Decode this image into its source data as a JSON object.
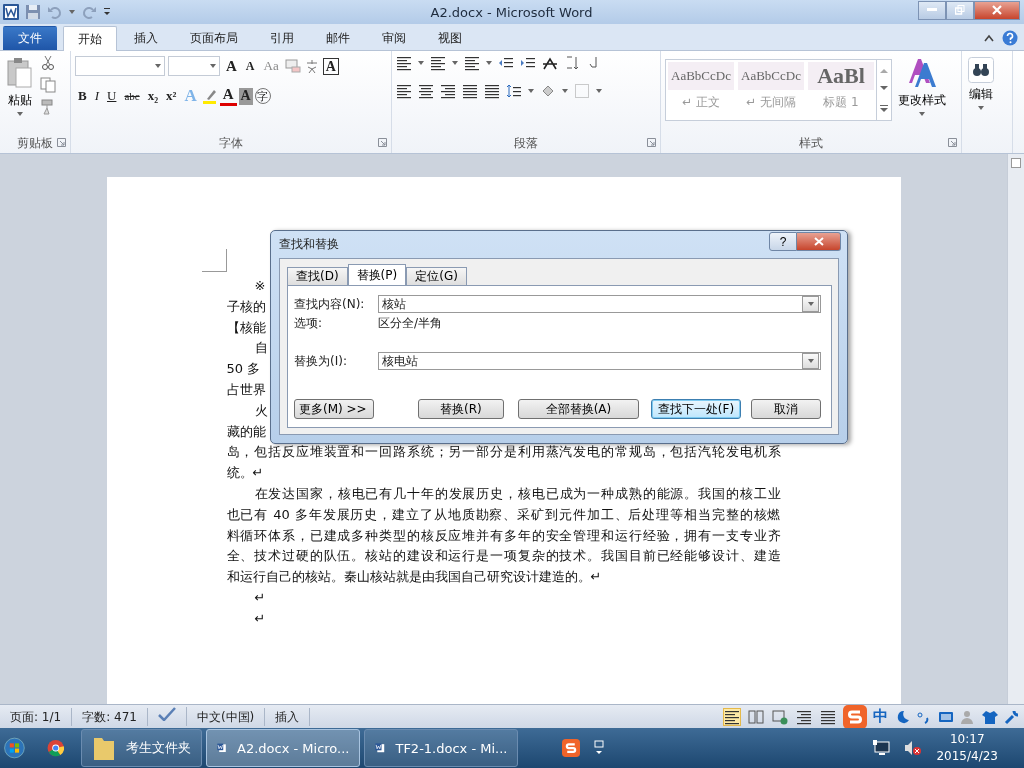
{
  "window": {
    "title": "A2.docx - Microsoft Word"
  },
  "ribbon_tabs": [
    {
      "label": "文件",
      "kind": "file",
      "selected": false
    },
    {
      "label": "开始",
      "kind": "tab",
      "selected": true
    },
    {
      "label": "插入",
      "kind": "tab",
      "selected": false
    },
    {
      "label": "页面布局",
      "kind": "tab",
      "selected": false
    },
    {
      "label": "引用",
      "kind": "tab",
      "selected": false
    },
    {
      "label": "邮件",
      "kind": "tab",
      "selected": false
    },
    {
      "label": "审阅",
      "kind": "tab",
      "selected": false
    },
    {
      "label": "视图",
      "kind": "tab",
      "selected": false
    }
  ],
  "clipboard": {
    "paste": "粘贴",
    "group": "剪贴板"
  },
  "font": {
    "group": "字体",
    "grow": "A",
    "shrink": "A",
    "case": "Aa",
    "border_char": "A",
    "format": [
      {
        "label": "B",
        "kind": "bold"
      },
      {
        "label": "I",
        "kind": "italic"
      },
      {
        "label": "U",
        "kind": "underline"
      },
      {
        "label": "abc",
        "kind": "strike"
      },
      {
        "label": "x₂",
        "kind": "sub"
      },
      {
        "label": "x²",
        "kind": "sup"
      }
    ],
    "effect": "A",
    "font_color_char": "A",
    "shading": "A",
    "enclose": "字"
  },
  "paragraph": {
    "group": "段落"
  },
  "styles": {
    "group": "样式",
    "items": [
      {
        "sample": "AaBbCcDc",
        "name": "↵ 正文",
        "kind": "normal"
      },
      {
        "sample": "AaBbCcDc",
        "name": "↵ 无间隔",
        "kind": "normal"
      },
      {
        "sample": "AaBl",
        "name": "标题 1",
        "kind": "heading"
      }
    ],
    "change": "更改样式"
  },
  "editing": {
    "label": "编辑"
  },
  "document": {
    "lines": [
      {
        "text": "※",
        "kind": "indent"
      },
      {
        "text": "子核的",
        "kind": "plain"
      },
      {
        "text": "【核能",
        "kind": "plain"
      },
      {
        "text": "自",
        "kind": "indent"
      },
      {
        "text": "50 多",
        "kind": "plain"
      },
      {
        "text": "占世界",
        "kind": "plain"
      },
      {
        "text": "火",
        "kind": "indent"
      },
      {
        "text": "藏的能",
        "kind": "plain"
      },
      {
        "text": "岛，包括反应堆装置和一回路系统；另一部分是利用蒸汽发电的常规岛，包括汽轮发电机系",
        "kind": "full"
      },
      {
        "text": "统。↵",
        "kind": "plain"
      },
      {
        "text": "在发达国家，核电已有几十年的发展历史，核电已成为一种成熟的能源。我国的核工业",
        "kind": "indent-full"
      },
      {
        "text": "也已有 40 多年发展历史，建立了从地质勘察、采矿到元件加工、后处理等相当完整的核燃",
        "kind": "full"
      },
      {
        "text": "料循环体系，已建成多种类型的核反应堆并有多年的安全管理和运行经验，拥有一支专业齐",
        "kind": "full"
      },
      {
        "text": "全、技术过硬的队伍。核站的建设和运行是一项复杂的技术。我国目前已经能够设计、建造",
        "kind": "full"
      },
      {
        "text": "和运行自己的核站。秦山核站就是由我国自己研究设计建造的。↵",
        "kind": "plain"
      },
      {
        "text": "↵",
        "kind": "indent"
      },
      {
        "text": "↵",
        "kind": "indent"
      }
    ]
  },
  "dialog": {
    "title": "查找和替换",
    "help": "?",
    "tabs": [
      {
        "label": "查找(D)",
        "selected": false
      },
      {
        "label": "替换(P)",
        "selected": true
      },
      {
        "label": "定位(G)",
        "selected": false
      }
    ],
    "find_label": "查找内容(N):",
    "find_value": "核站",
    "options_label": "选项:",
    "options_value": "区分全/半角",
    "replace_label": "替换为(I):",
    "replace_value": "核电站",
    "buttons": [
      {
        "label": "更多(M) >>",
        "kind": "more",
        "default": false
      },
      {
        "label": "替换(R)",
        "kind": "action",
        "default": false
      },
      {
        "label": "全部替换(A)",
        "kind": "action",
        "default": false
      },
      {
        "label": "查找下一处(F)",
        "kind": "action",
        "default": true
      },
      {
        "label": "取消",
        "kind": "action",
        "default": false
      }
    ]
  },
  "status_bar": {
    "items": [
      {
        "text": "页面: 1/1",
        "kind": "text"
      },
      {
        "text": "字数: 471",
        "kind": "text"
      },
      {
        "kind": "proofing"
      },
      {
        "text": "中文(中国)",
        "kind": "text"
      },
      {
        "text": "插入",
        "kind": "text"
      }
    ],
    "ime": "中"
  },
  "taskbar": {
    "buttons": [
      {
        "label": "考生文件夹",
        "kind": "folder",
        "selected": false
      },
      {
        "label": "A2.docx - Micro...",
        "kind": "word",
        "selected": true
      },
      {
        "label": "TF2-1.docx - Mi...",
        "kind": "word",
        "selected": false
      }
    ],
    "time": "10:17",
    "date": "2015/4/23"
  }
}
